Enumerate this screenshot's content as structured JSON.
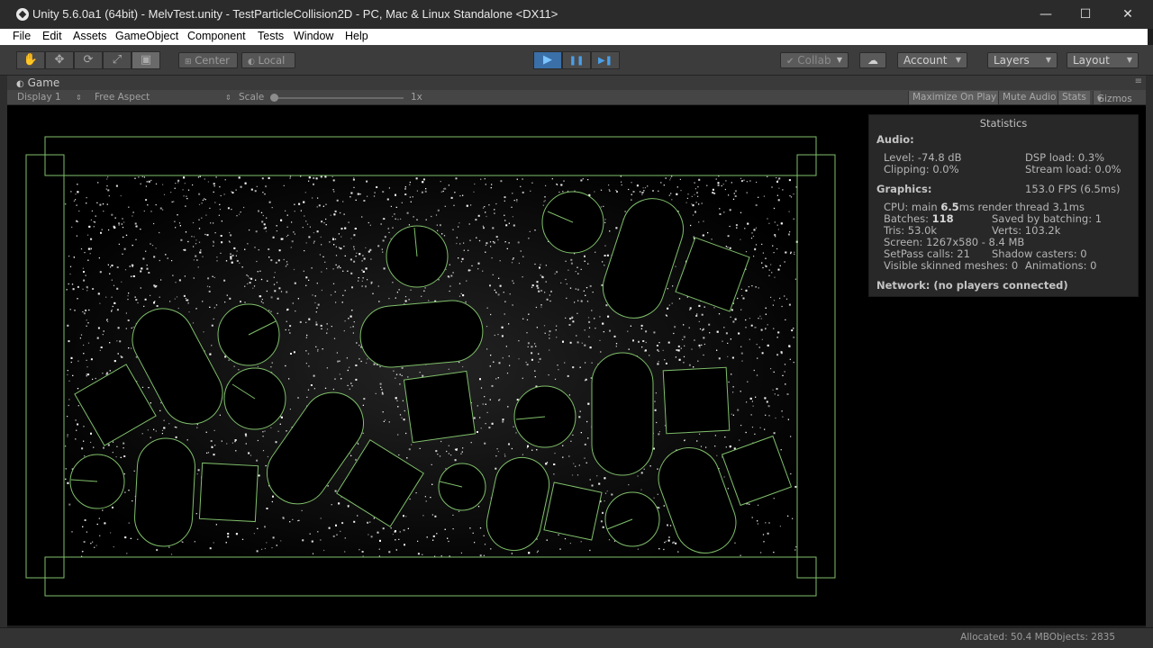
{
  "window": {
    "title": "Unity 5.6.0a1 (64bit) - MelvTest.unity - TestParticleCollision2D - PC, Mac & Linux Standalone <DX11>",
    "minimize": "—",
    "maximize": "☐",
    "close": "✕"
  },
  "menu": [
    "File",
    "Edit",
    "Assets",
    "GameObject",
    "Component",
    "Tests",
    "Window",
    "Help"
  ],
  "toolbar": {
    "tools": [
      "hand-icon",
      "move-icon",
      "rotate-icon",
      "scale-icon",
      "rect-tool-icon"
    ],
    "pivot": "Center",
    "space": "Local",
    "play": "▶",
    "pause": "❚❚",
    "step": "▶❚",
    "collab": "Collab",
    "account": "Account",
    "layers": "Layers",
    "layout": "Layout"
  },
  "game_tab": {
    "label": "Game",
    "display": "Display 1",
    "aspect": "Free Aspect",
    "scale_label": "Scale",
    "scale_value": "1x",
    "maximize_on_play": "Maximize On Play",
    "mute_audio": "Mute Audio",
    "stats": "Stats",
    "gizmos": "Gizmos"
  },
  "statistics": {
    "title": "Statistics",
    "audio_header": "Audio:",
    "level": "Level: -74.8 dB",
    "clipping": "Clipping: 0.0%",
    "dsp_load": "DSP load: 0.3%",
    "stream_load": "Stream load: 0.0%",
    "graphics_header": "Graphics:",
    "fps": "153.0 FPS (6.5ms)",
    "cpu_prefix": "CPU: main ",
    "cpu_main": "6.5",
    "cpu_suffix": "ms  render thread 3.1ms",
    "batches_prefix": "Batches: ",
    "batches": "118",
    "saved_by_batching": "Saved by batching: 1",
    "tris": "Tris: 53.0k",
    "verts": "Verts: 103.2k",
    "screen": "Screen: 1267x580 - 8.4 MB",
    "setpass": "SetPass calls: 21",
    "shadow_casters": "Shadow casters: 0",
    "skinned": "Visible skinned meshes: 0",
    "animations": "Animations: 0",
    "network": "Network: (no players connected)"
  },
  "status": {
    "allocated": "Allocated: 50.4 MBObjects: 2835"
  },
  "colors": {
    "collider": "#7fbf6a",
    "particle": "#ffffff",
    "play_active": "#3a6fa8"
  }
}
